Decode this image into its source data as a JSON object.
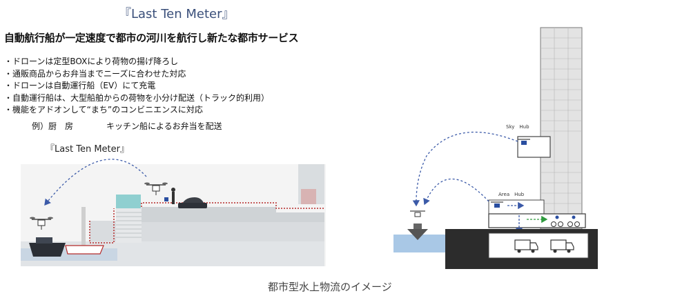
{
  "top_title": "『Last Ten Meter』",
  "headline": "自動航行船が一定速度で都市の河川を航行し新たな都市サービス",
  "bullets": [
    "・ドローンは定型BOXにより荷物の揚げ降ろし",
    "・通販商品からお弁当までニーズに合わせた対応",
    "・ドローンは自動運行船（EV）にて充電",
    "・自動運行船は、大型船舶からの荷物を小分け配送（トラック的利用）",
    "・機能をアドオンして“まち”のコンビニエンスに対応"
  ],
  "example": {
    "label": "例）厨　房",
    "text": "キッチン船によるお弁当を配送"
  },
  "sub_title": "『Last Ten Meter』",
  "right_diagram": {
    "sky_hub_label": "Sky　Hub",
    "area_hub_label": "Area　Hub"
  },
  "caption": "都市型水上物流のイメージ",
  "colors": {
    "title_blue": "#3a4f7a",
    "arrow_blue": "#3b5aa8",
    "arrow_green": "#2e9a3e",
    "dock_red": "#b52a2a",
    "water_blue": "#a9c8e6",
    "ground": "#2c2c2c"
  }
}
